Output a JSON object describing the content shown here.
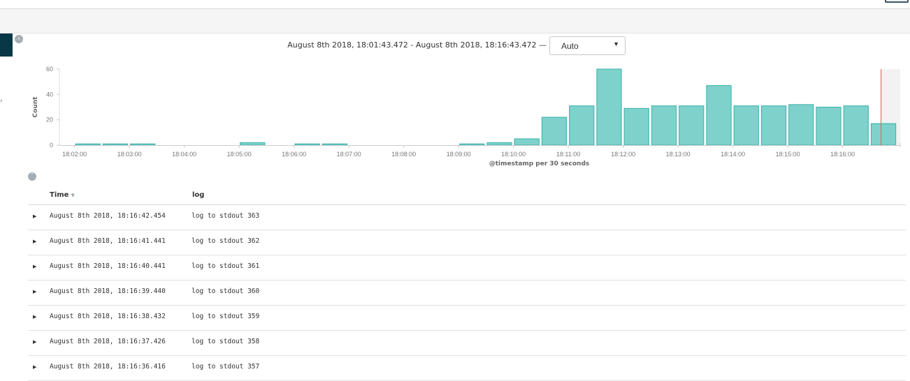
{
  "header": {
    "time_range": "August 8th 2018, 18:01:43.472 - August 8th 2018, 18:16:43.472 —",
    "interval": "Auto"
  },
  "icons": {
    "collapse_chart": "chevron-left-circle-icon",
    "collapse_table": "chevron-up-circle-icon",
    "sort": "sort-down-icon",
    "expand": "triangle-right-icon"
  },
  "colors": {
    "bar_fill": "#7fd1cc",
    "bar_stroke": "#35b2a9",
    "now_marker": "#e36666",
    "sidebar": "#083748"
  },
  "chart_data": {
    "type": "bar",
    "ylabel": "Count",
    "xlabel": "@timestamp per 30 seconds",
    "ylim": [
      0,
      60
    ],
    "yticks": [
      0,
      20,
      40,
      60
    ],
    "x_ticks": [
      "18:02:00",
      "18:03:00",
      "18:04:00",
      "18:05:00",
      "18:06:00",
      "18:07:00",
      "18:08:00",
      "18:09:00",
      "18:10:00",
      "18:11:00",
      "18:12:00",
      "18:13:00",
      "18:14:00",
      "18:15:00",
      "18:16:00"
    ],
    "bars": [
      {
        "start": "18:02:00",
        "value": 1
      },
      {
        "start": "18:02:30",
        "value": 1
      },
      {
        "start": "18:03:00",
        "value": 1
      },
      {
        "start": "18:05:00",
        "value": 2
      },
      {
        "start": "18:06:00",
        "value": 1
      },
      {
        "start": "18:06:30",
        "value": 1
      },
      {
        "start": "18:09:00",
        "value": 1
      },
      {
        "start": "18:09:30",
        "value": 2
      },
      {
        "start": "18:10:00",
        "value": 5
      },
      {
        "start": "18:10:30",
        "value": 22
      },
      {
        "start": "18:11:00",
        "value": 31
      },
      {
        "start": "18:11:30",
        "value": 60
      },
      {
        "start": "18:12:00",
        "value": 29
      },
      {
        "start": "18:12:30",
        "value": 31
      },
      {
        "start": "18:13:00",
        "value": 31
      },
      {
        "start": "18:13:30",
        "value": 47
      },
      {
        "start": "18:14:00",
        "value": 31
      },
      {
        "start": "18:14:30",
        "value": 31
      },
      {
        "start": "18:15:00",
        "value": 32
      },
      {
        "start": "18:15:30",
        "value": 30
      },
      {
        "start": "18:16:00",
        "value": 31
      },
      {
        "start": "18:16:30",
        "value": 17
      }
    ],
    "grid": false,
    "legend": "none"
  },
  "table": {
    "columns": [
      "Time",
      "log"
    ],
    "rows": [
      {
        "time": "August 8th 2018, 18:16:42.454",
        "log": "log to stdout 363"
      },
      {
        "time": "August 8th 2018, 18:16:41.441",
        "log": "log to stdout 362"
      },
      {
        "time": "August 8th 2018, 18:16:40.441",
        "log": "log to stdout 361"
      },
      {
        "time": "August 8th 2018, 18:16:39.440",
        "log": "log to stdout 360"
      },
      {
        "time": "August 8th 2018, 18:16:38.432",
        "log": "log to stdout 359"
      },
      {
        "time": "August 8th 2018, 18:16:37.426",
        "log": "log to stdout 358"
      },
      {
        "time": "August 8th 2018, 18:16:36.416",
        "log": "log to stdout 357"
      }
    ]
  }
}
